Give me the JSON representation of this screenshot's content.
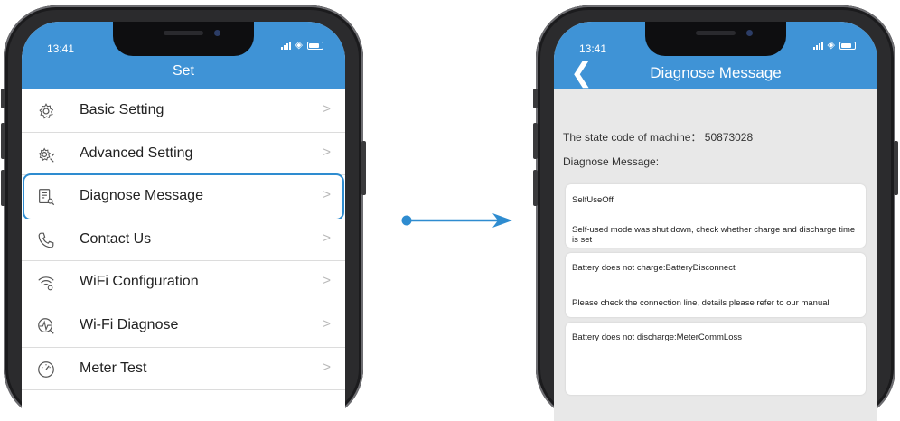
{
  "left_screen": {
    "time": "13:41",
    "title": "Set",
    "menu": [
      {
        "label": "Basic Setting",
        "icon": "gear-icon"
      },
      {
        "label": "Advanced Setting",
        "icon": "advanced-gear-icon"
      },
      {
        "label": "Diagnose Message",
        "icon": "document-search-icon",
        "highlighted": true
      },
      {
        "label": "Contact Us",
        "icon": "phone-icon"
      },
      {
        "label": "WiFi Configuration",
        "icon": "wifi-config-icon"
      },
      {
        "label": "Wi-Fi Diagnose",
        "icon": "signal-diagnose-icon"
      },
      {
        "label": "Meter Test",
        "icon": "meter-gauge-icon"
      }
    ]
  },
  "right_screen": {
    "time": "13:41",
    "title": "Diagnose Message",
    "state_code_label": "The state code of machine：",
    "state_code_value": "50873028",
    "diagnose_label": "Diagnose Message:",
    "messages": [
      {
        "title": "SelfUseOff",
        "detail": "Self-used mode was shut down, check whether charge and discharge time is set"
      },
      {
        "title": "Battery does not charge:BatteryDisconnect",
        "detail": "Please check the connection line, details please refer to our manual"
      },
      {
        "title": "Battery does not discharge:MeterCommLoss",
        "detail": ""
      }
    ]
  },
  "colors": {
    "header_blue": "#3f93d6",
    "highlight_border": "#2e8cd0",
    "arrow": "#2e8cd0",
    "phone_frame": "#2b2b2d"
  }
}
